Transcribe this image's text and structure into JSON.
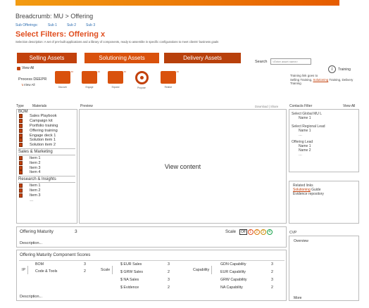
{
  "breadcrumb": "Breadcrumb: MU > Offering",
  "subnav": [
    "Sub Offerings:",
    "Sub 1",
    "Sub 2",
    "Sub 3"
  ],
  "page_title": "Select Filters: Offering x",
  "description": "Selection description: A set of pre-built applications and a library of components, ready to assemble in specific configurations to meet clients' business goals",
  "tabs": [
    "Selling Assets",
    "Solutioning Assets",
    "Delivery Assets"
  ],
  "view_all": "View All",
  "search": {
    "label": "Search",
    "placeholder": "<Enter asset name>"
  },
  "training": {
    "label": "Training",
    "text1": "Training link goes to",
    "link_a": "Selling Training,",
    "link_b": "Solutioning",
    "link_c": " Training, Delivery Training"
  },
  "process": {
    "label": "Process DEEPR",
    "view_all": "View All",
    "steps": [
      {
        "caption": "Discover",
        "badge": "40"
      },
      {
        "caption": "Engage",
        "badge": "40"
      },
      {
        "caption": "Expand",
        "badge": "40"
      },
      {
        "caption": "Propose",
        "badge": "40"
      },
      {
        "caption": "Realize",
        "badge": "40"
      }
    ]
  },
  "headers": {
    "type": "Type",
    "materials": "Materials",
    "preview": "Preview",
    "download": "Download | Share",
    "contacts": "Contacts Filter",
    "contacts_view_all": "View All"
  },
  "bom": {
    "title": "BOM",
    "items": [
      "Sales Playbook",
      "Campaign kit",
      "Portfolio training",
      "Offering training",
      "Engage deck 1",
      "Solution item 1",
      "Solution item 2"
    ]
  },
  "sales_marketing": {
    "title": "Sales & Marketing",
    "items": [
      "Item 1",
      "Item 2",
      "Item 3",
      "Item 4"
    ]
  },
  "research": {
    "title": "Research & Insights",
    "items": [
      "Item 1",
      "Item 2",
      "Item 3"
    ],
    "more": "…"
  },
  "view_content": "View content",
  "contacts": {
    "global_label": "Select Global MU L",
    "global_name": "Name 1",
    "regional_label": "Select Regional Lead",
    "regional_name": "Name 1",
    "regional_more": "…",
    "offering_label": "Offering Lead",
    "offering_name1": "Name 1",
    "offering_name2": "Name 2",
    "offering_more": "…"
  },
  "related": {
    "title": "Related links",
    "link1": "Solutioning",
    "link1_suffix": " Guide",
    "link2": "Evidence repository"
  },
  "maturity": {
    "title": "Offering Maturity",
    "value": "3",
    "scale_label": "Scale",
    "scale": [
      "Off",
      "1",
      "2",
      "3",
      "4"
    ],
    "description": "Description..."
  },
  "cvp": {
    "title": "CVP",
    "overview": "Overview",
    "more": "More"
  },
  "components": {
    "title": "Offering Maturity Component Scores",
    "ip_label": "IP",
    "ip_rows": [
      {
        "name": "BOM",
        "value": "3"
      },
      {
        "name": "Code & Tools",
        "value": "2"
      }
    ],
    "scale_label": "Scale",
    "scale_rows": [
      {
        "name": "$ EUR Sales",
        "value": "3"
      },
      {
        "name": "$ GRW Sales",
        "value": "2"
      },
      {
        "name": "$ NA Sales",
        "value": "3"
      },
      {
        "name": "$ Evidence",
        "value": "2"
      }
    ],
    "capability_label": "Capability",
    "capability_rows": [
      {
        "name": "GDN Capability",
        "value": "3"
      },
      {
        "name": "EUR Capability",
        "value": "2"
      },
      {
        "name": "GRW Capability",
        "value": "3"
      },
      {
        "name": "NA Capability",
        "value": "2"
      }
    ],
    "description": "Description..."
  },
  "colors": {
    "accent": "#c2410c",
    "link": "#2b6cb0"
  }
}
